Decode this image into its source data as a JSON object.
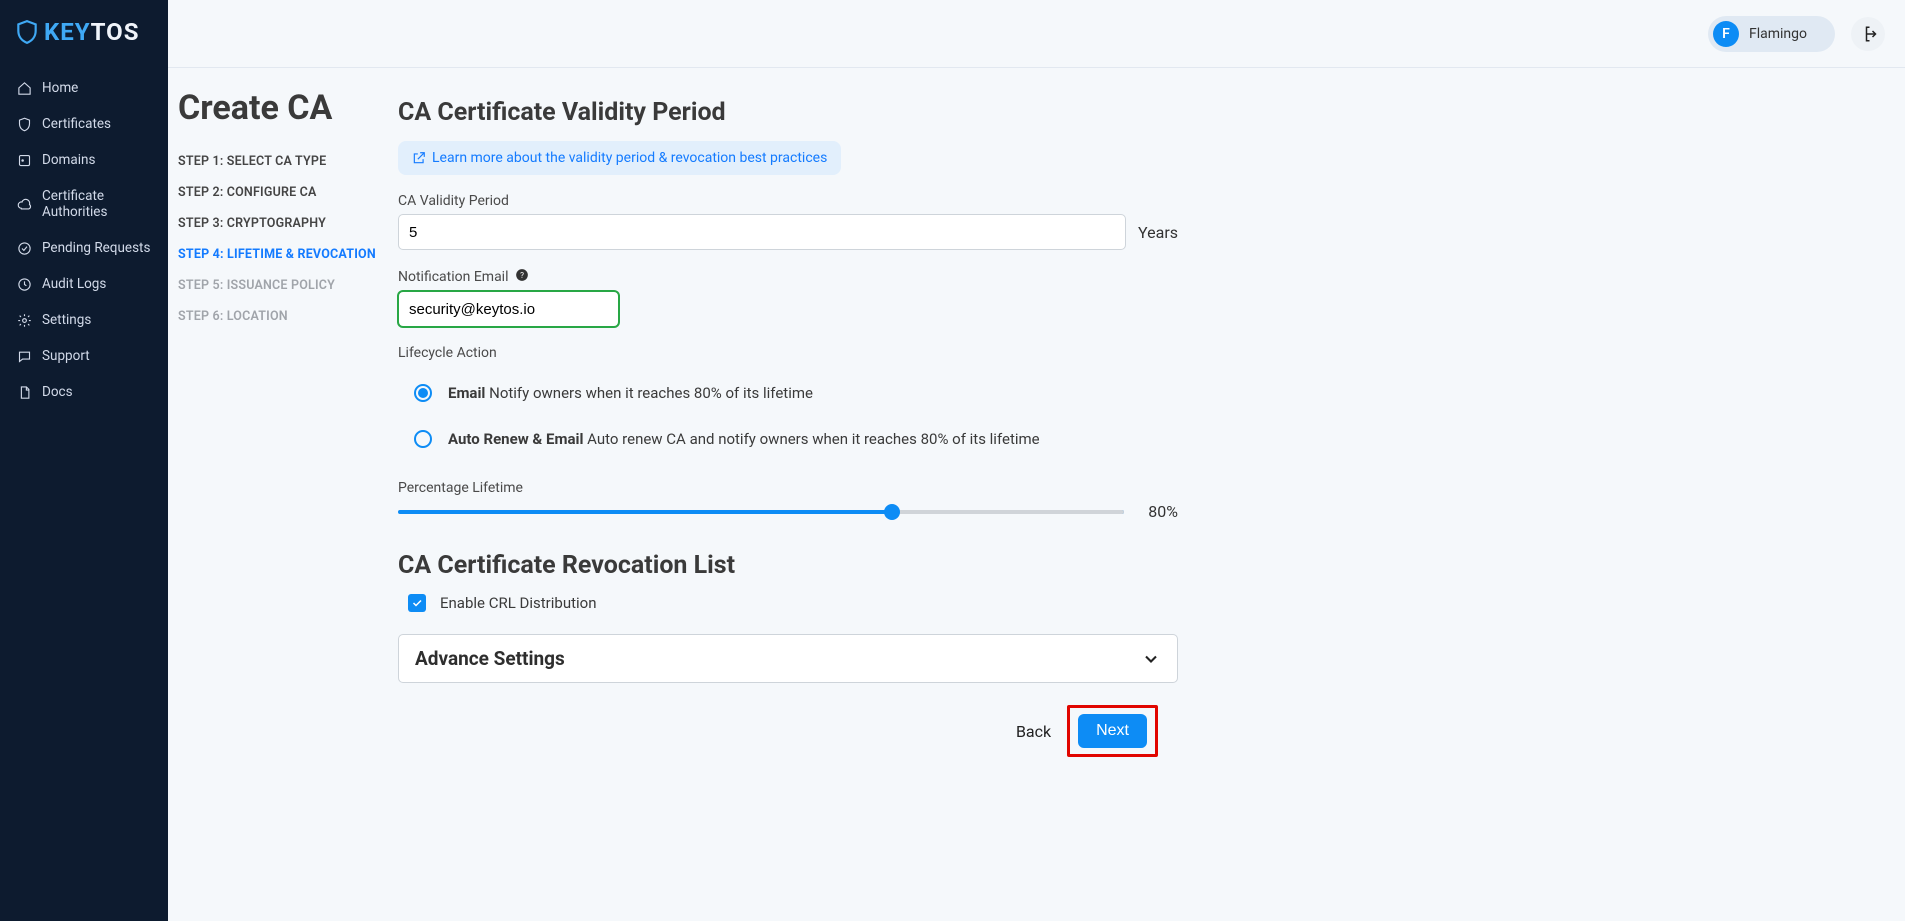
{
  "brand": {
    "name_a": "KEY",
    "name_b": "TOS"
  },
  "user": {
    "initial": "F",
    "name": "Flamingo"
  },
  "sidebar": {
    "items": [
      {
        "label": "Home"
      },
      {
        "label": "Certificates"
      },
      {
        "label": "Domains"
      },
      {
        "label": "Certificate Authorities"
      },
      {
        "label": "Pending Requests"
      },
      {
        "label": "Audit Logs"
      },
      {
        "label": "Settings"
      },
      {
        "label": "Support"
      },
      {
        "label": "Docs"
      }
    ]
  },
  "page": {
    "title": "Create CA"
  },
  "steps": [
    {
      "label": "STEP 1: SELECT CA TYPE"
    },
    {
      "label": "STEP 2: CONFIGURE CA"
    },
    {
      "label": "STEP 3: CRYPTOGRAPHY"
    },
    {
      "label": "STEP 4: LIFETIME & REVOCATION"
    },
    {
      "label": "STEP 5: ISSUANCE POLICY"
    },
    {
      "label": "STEP 6: LOCATION"
    }
  ],
  "form": {
    "section1_title": "CA Certificate Validity Period",
    "learn_more": "Learn more about the validity period & revocation best practices",
    "validity_label": "CA Validity Period",
    "validity_value": "5",
    "validity_unit": "Years",
    "email_label": "Notification Email",
    "email_value": "security@keytos.io",
    "lifecycle_label": "Lifecycle Action",
    "radio_email_label": "Email",
    "radio_email_desc": " Notify owners when it reaches 80% of its lifetime",
    "radio_auto_label": "Auto Renew & Email",
    "radio_auto_desc": " Auto renew CA and notify owners when it reaches 80% of its lifetime",
    "pct_label": "Percentage Lifetime",
    "pct_value": "80%",
    "section2_title": "CA Certificate Revocation List",
    "crl_label": "Enable CRL Distribution",
    "advance_title": "Advance Settings",
    "back": "Back",
    "next": "Next"
  }
}
